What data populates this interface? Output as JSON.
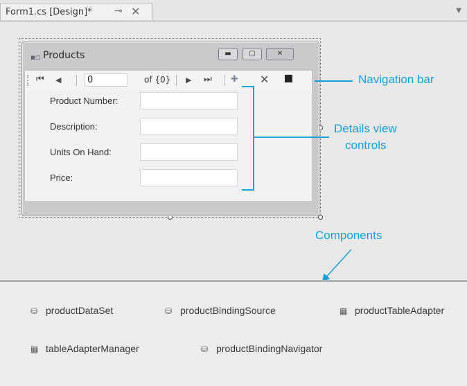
{
  "tab": {
    "title": "Form1.cs [Design]*",
    "pin_glyph": "⊸",
    "close_glyph": "✕",
    "dropdown_glyph": "▼"
  },
  "form": {
    "title": "Products",
    "min_glyph": "▬",
    "max_glyph": "▢",
    "close_glyph": "✕"
  },
  "navigator": {
    "first_glyph": "⏮",
    "prev_glyph": "◀",
    "position": "0",
    "count_label": "of {0}",
    "next_glyph": "▶",
    "last_glyph": "⏭",
    "add_glyph": "✚",
    "delete_glyph": "✕",
    "save_glyph": "▪"
  },
  "fields": [
    {
      "label": "Product Number:",
      "value": ""
    },
    {
      "label": "Description:",
      "value": ""
    },
    {
      "label": "Units On Hand:",
      "value": ""
    },
    {
      "label": "Price:",
      "value": ""
    }
  ],
  "callouts": {
    "navigation_bar": "Navigation bar",
    "details_line1": "Details view",
    "details_line2": "controls",
    "components": "Components"
  },
  "components": [
    {
      "name": "productDataSet",
      "icon": "dataset-icon"
    },
    {
      "name": "productBindingSource",
      "icon": "bindingsource-icon"
    },
    {
      "name": "productTableAdapter",
      "icon": "tableadapter-icon"
    },
    {
      "name": "tableAdapterManager",
      "icon": "tableadapter-icon"
    },
    {
      "name": "productBindingNavigator",
      "icon": "bindingnavigator-icon"
    }
  ],
  "colors": {
    "callout": "#1a9fd8",
    "designer_background": "#e8e8e8"
  }
}
